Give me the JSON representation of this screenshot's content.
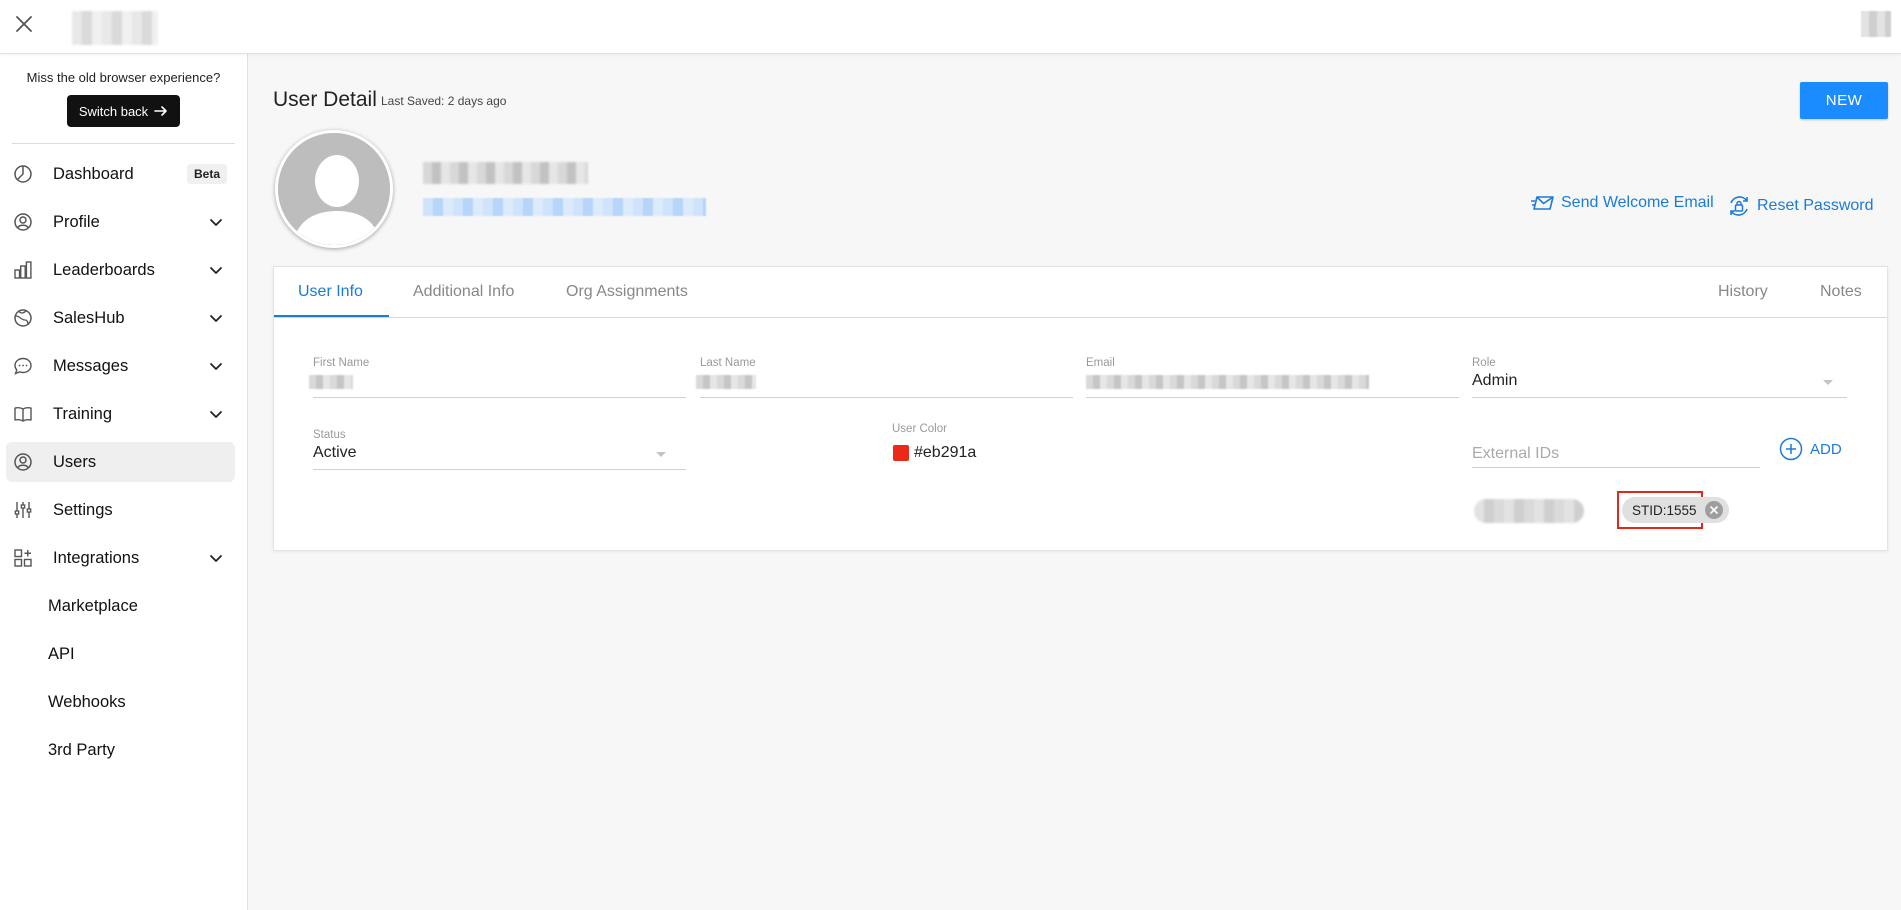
{
  "topbar": {
    "close_icon": "close-icon"
  },
  "sidebar": {
    "old_experience_text": "Miss the old browser experience?",
    "switch_back_label": "Switch back",
    "items": [
      {
        "label": "Dashboard",
        "icon": "pie-chart-icon",
        "badge": "Beta",
        "expandable": false
      },
      {
        "label": "Profile",
        "icon": "user-circle-icon",
        "expandable": true
      },
      {
        "label": "Leaderboards",
        "icon": "bar-chart-icon",
        "expandable": true
      },
      {
        "label": "SalesHub",
        "icon": "globe-icon",
        "expandable": true
      },
      {
        "label": "Messages",
        "icon": "chat-bubble-icon",
        "expandable": true
      },
      {
        "label": "Training",
        "icon": "book-icon",
        "expandable": true
      },
      {
        "label": "Users",
        "icon": "user-circle-icon",
        "expandable": false,
        "active": true
      },
      {
        "label": "Settings",
        "icon": "sliders-icon",
        "expandable": false
      },
      {
        "label": "Integrations",
        "icon": "grid-plus-icon",
        "expandable": true
      }
    ],
    "sub_items": [
      "Marketplace",
      "API",
      "Webhooks",
      "3rd Party"
    ]
  },
  "header": {
    "title": "User Detail",
    "last_saved": "Last Saved:  2 days ago",
    "new_button": "NEW"
  },
  "actions": {
    "send_welcome": "Send Welcome Email",
    "reset_password": "Reset Password"
  },
  "tabs": {
    "left": [
      "User Info",
      "Additional Info",
      "Org Assignments"
    ],
    "right": [
      "History",
      "Notes"
    ],
    "active": "User Info"
  },
  "form": {
    "first_name_label": "First Name",
    "last_name_label": "Last Name",
    "email_label": "Email",
    "role_label": "Role",
    "role_value": "Admin",
    "status_label": "Status",
    "status_value": "Active",
    "user_color_label": "User Color",
    "user_color_value": "#eb291a",
    "external_ids_placeholder": "External IDs",
    "add_label": "ADD",
    "chip_label": "STID:1555"
  },
  "colors": {
    "accent": "#1a7bd8",
    "new_button": "#1a8cff",
    "highlight": "#e0281b",
    "user_color": "#eb291a"
  }
}
